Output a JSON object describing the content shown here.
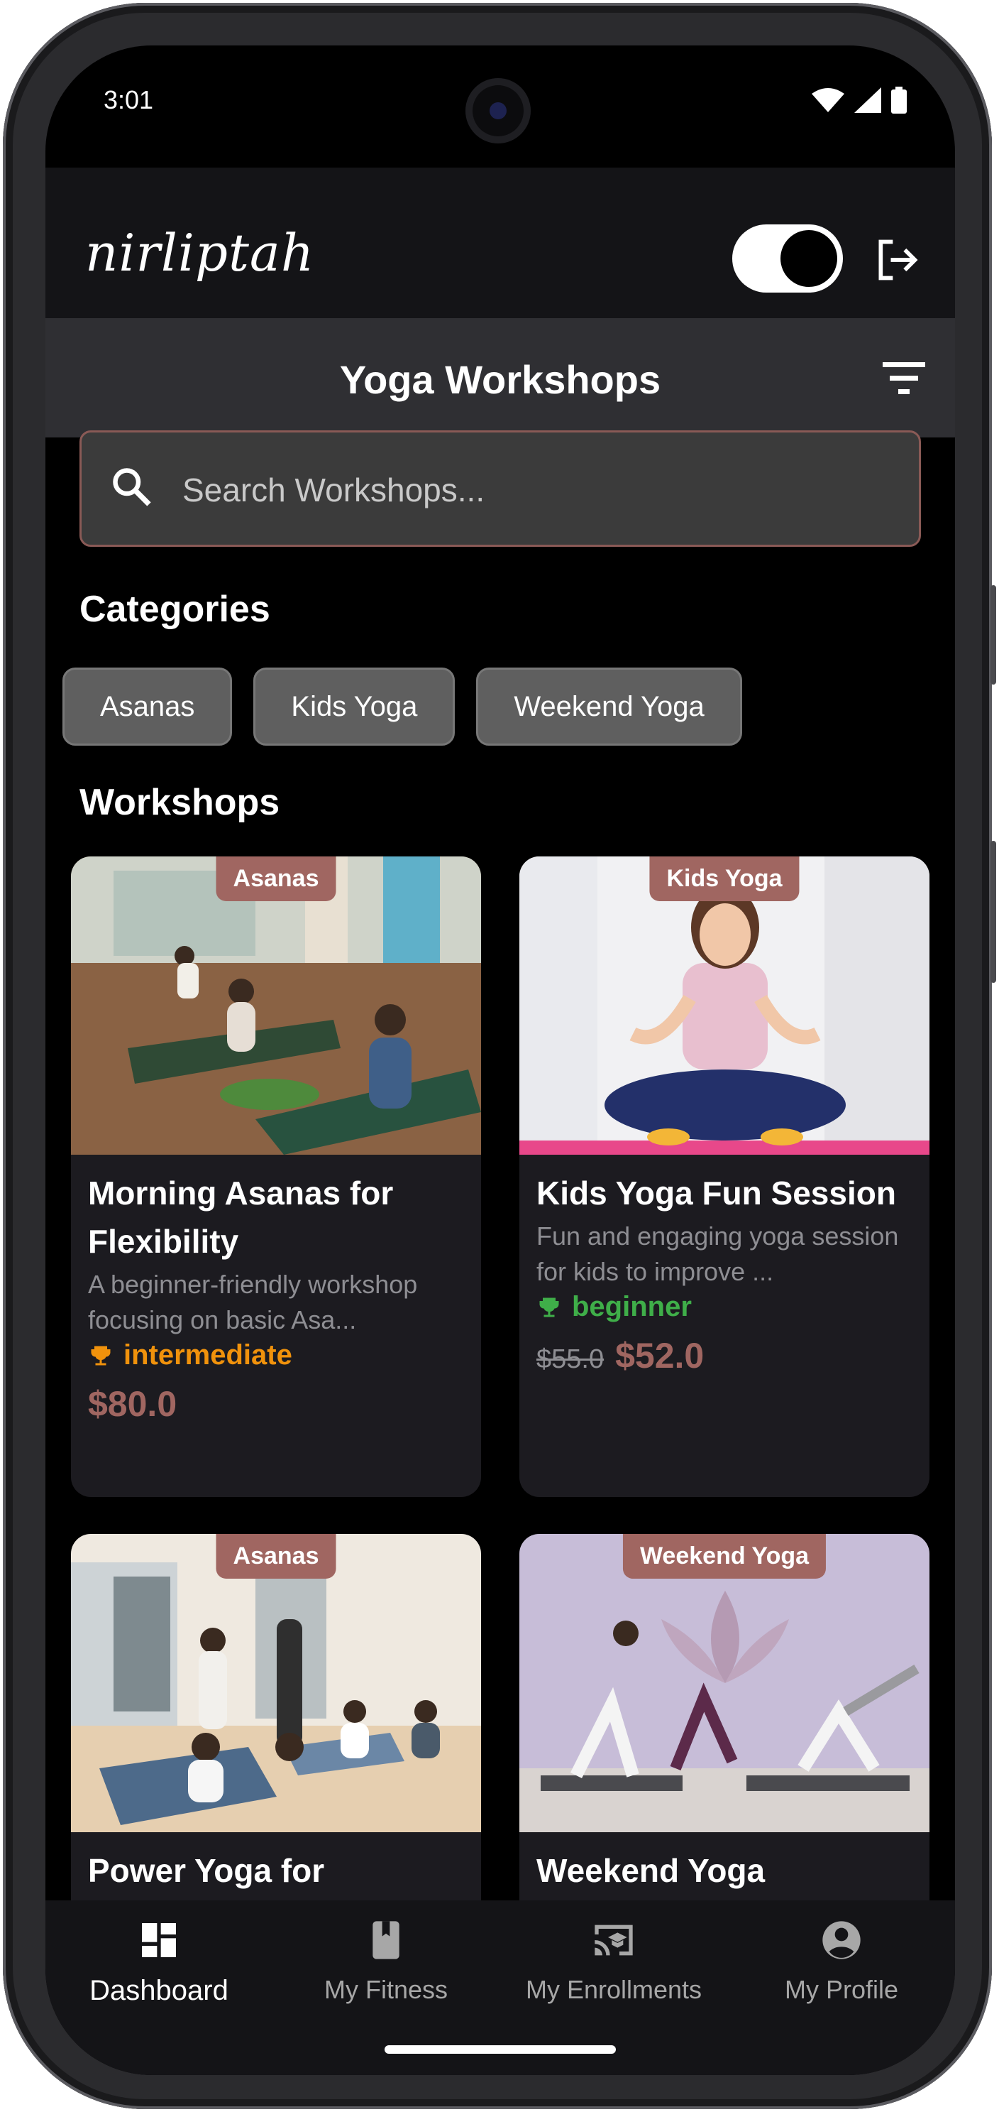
{
  "status_bar": {
    "time": "3:01"
  },
  "header": {
    "logo_text": "nirliptah",
    "theme_toggle_on": true,
    "title": "Yoga Workshops"
  },
  "search": {
    "placeholder": "Search Workshops..."
  },
  "sections": {
    "categories": "Categories",
    "workshops": "Workshops"
  },
  "categories": [
    {
      "label": "Asanas"
    },
    {
      "label": "Kids Yoga"
    },
    {
      "label": "Weekend Yoga"
    }
  ],
  "workshops": [
    {
      "tag": "Asanas",
      "title": "Morning Asanas for Flexibility",
      "description": "A beginner-friendly workshop focusing on basic Asa...",
      "level": "intermediate",
      "level_color": "#f0920c",
      "price": "$80.0"
    },
    {
      "tag": "Kids Yoga",
      "title": "Kids Yoga Fun Session",
      "description": "Fun and engaging yoga session for kids to improve ...",
      "level": "beginner",
      "level_color": "#3fae49",
      "old_price": "$55.0",
      "price": "$52.0"
    },
    {
      "tag": "Asanas",
      "title": "Power Yoga for"
    },
    {
      "tag": "Weekend Yoga",
      "title": "Weekend Yoga"
    }
  ],
  "bottom_nav": [
    {
      "label": "Dashboard",
      "icon": "dashboard-icon",
      "active": true
    },
    {
      "label": "My Fitness",
      "icon": "book-icon",
      "active": false
    },
    {
      "label": "My Enrollments",
      "icon": "cast-school-icon",
      "active": false
    },
    {
      "label": "My Profile",
      "icon": "account-circle-icon",
      "active": false
    }
  ],
  "colors": {
    "accent": "#a06661",
    "background": "#000000",
    "card": "#1c1b20",
    "header": "#141417",
    "title_bar": "#2f2f33"
  }
}
